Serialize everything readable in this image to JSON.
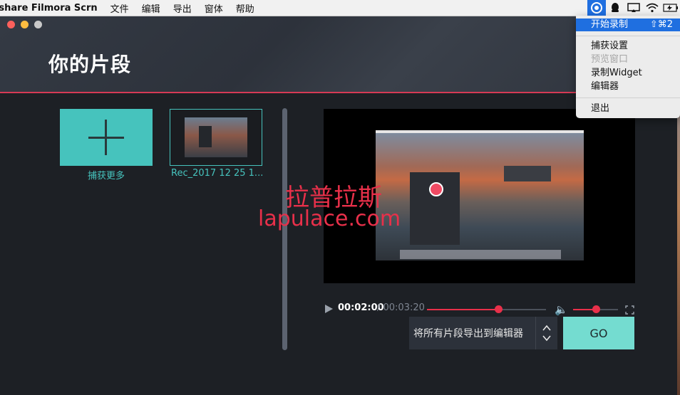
{
  "menubar": {
    "app_name": "rshare Filmora Scrn",
    "items": [
      "文件",
      "编辑",
      "导出",
      "窗体",
      "帮助"
    ],
    "status_icons": [
      "record-icon",
      "qq-icon",
      "screen-share-icon",
      "wifi-icon",
      "battery-icon"
    ]
  },
  "dropdown": {
    "start_record": "开始录制",
    "start_record_shortcut": "⇧⌘2",
    "capture_settings": "捕获设置",
    "preview_window": "预览窗口",
    "record_widget": "录制Widget",
    "editor": "编辑器",
    "quit": "退出"
  },
  "window": {
    "title": "你的片段",
    "add_clip_label": "捕获更多",
    "clip_label": "Rec_2017 12 25 1..."
  },
  "watermark": {
    "cn": "拉普拉斯",
    "en": "lapulace.com"
  },
  "player": {
    "current_time": "00:02:00",
    "total_time": " / 00:03:20",
    "progress": 0.6,
    "volume": 0.5
  },
  "export": {
    "select_label": "将所有片段导出到编辑器",
    "go_label": "GO"
  },
  "colors": {
    "accent_teal": "#46c3bd",
    "go_teal": "#74dcd0",
    "accent_red": "#e8304a",
    "menu_highlight": "#1f6fe0"
  }
}
